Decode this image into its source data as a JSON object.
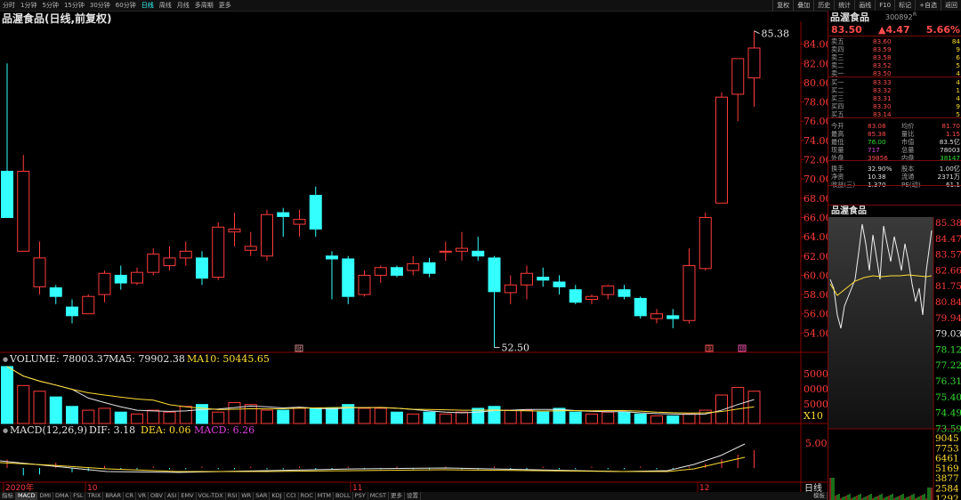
{
  "toolbar": {
    "periods": [
      "分时",
      "1分钟",
      "5分钟",
      "15分钟",
      "30分钟",
      "60分钟",
      "日线",
      "周线",
      "月线",
      "多周期",
      "更多"
    ],
    "active_period": "日线",
    "tools": [
      "复权",
      "叠加",
      "历史",
      "统计",
      "画线",
      "F10",
      "标记",
      "+自选",
      "返回"
    ]
  },
  "chart": {
    "title": "品渥食品(日线,前复权)",
    "price_ticks": [
      "84.00",
      "82.00",
      "80.00",
      "78.00",
      "76.00",
      "74.00",
      "72.00",
      "70.00",
      "68.00",
      "66.00",
      "64.00",
      "62.00",
      "60.00",
      "58.00",
      "56.00",
      "54.00"
    ],
    "high_label": "85.38",
    "low_label": "52.50",
    "markers": [
      "财",
      "涨",
      "预"
    ],
    "volume_legend": {
      "vol": "VOLUME: 78003.37",
      "ma5": "MA5: 79902.38",
      "ma10": "MA10: 50445.65"
    },
    "volume_ticks": [
      "5000",
      "0000",
      "5000",
      "X10"
    ],
    "macd_legend": {
      "params": "MACD(12,26,9)",
      "dif": "DIF: 3.18",
      "dea": "DEA: 0.06",
      "macd": "MACD: 6.26"
    },
    "macd_ticks": [
      "5.00"
    ],
    "date_labels": [
      "2020年",
      "10",
      "11",
      "12"
    ],
    "bottom_right_label": "日线",
    "bottom_tabs": [
      "指标",
      "MACD",
      "DMI",
      "DMA",
      "FSL",
      "TRIX",
      "BRAR",
      "CR",
      "VR",
      "OBV",
      "ASI",
      "EMV",
      "VOL-TDX",
      "RSI",
      "WR",
      "SAR",
      "KDJ",
      "CCI",
      "ROC",
      "MTM",
      "BOLL",
      "PSY",
      "MCST",
      "更多",
      "设置"
    ],
    "bottom_tab_active": "MACD",
    "bottom_right_tab": "模板"
  },
  "chart_data": {
    "type": "candlestick",
    "candles": [
      {
        "o": 70.8,
        "c": 66.0,
        "h": 82.0,
        "l": 66.0
      },
      {
        "o": 62.5,
        "c": 70.8,
        "h": 72.5,
        "l": 62.5
      },
      {
        "o": 58.8,
        "c": 61.8,
        "h": 63.5,
        "l": 58.0
      },
      {
        "o": 58.7,
        "c": 57.8,
        "h": 59.0,
        "l": 57.0
      },
      {
        "o": 56.7,
        "c": 55.8,
        "h": 57.5,
        "l": 55.0
      },
      {
        "o": 56.0,
        "c": 57.8,
        "h": 58.0,
        "l": 56.0
      },
      {
        "o": 58.0,
        "c": 60.2,
        "h": 60.5,
        "l": 57.2
      },
      {
        "o": 60.0,
        "c": 59.2,
        "h": 61.0,
        "l": 58.5
      },
      {
        "o": 59.2,
        "c": 60.3,
        "h": 60.8,
        "l": 59.0
      },
      {
        "o": 60.3,
        "c": 62.2,
        "h": 62.8,
        "l": 60.0
      },
      {
        "o": 61.0,
        "c": 61.8,
        "h": 63.0,
        "l": 60.5
      },
      {
        "o": 61.8,
        "c": 62.5,
        "h": 63.5,
        "l": 61.0
      },
      {
        "o": 61.8,
        "c": 59.7,
        "h": 62.5,
        "l": 59.0
      },
      {
        "o": 59.8,
        "c": 65.0,
        "h": 65.5,
        "l": 59.5
      },
      {
        "o": 64.5,
        "c": 64.8,
        "h": 66.5,
        "l": 63.0
      },
      {
        "o": 62.6,
        "c": 63.0,
        "h": 64.5,
        "l": 62.0
      },
      {
        "o": 62.0,
        "c": 66.3,
        "h": 66.8,
        "l": 61.5
      },
      {
        "o": 66.5,
        "c": 66.1,
        "h": 67.0,
        "l": 64.0
      },
      {
        "o": 65.3,
        "c": 65.8,
        "h": 66.8,
        "l": 64.0
      },
      {
        "o": 68.3,
        "c": 64.8,
        "h": 69.2,
        "l": 64.0
      },
      {
        "o": 62.0,
        "c": 61.7,
        "h": 62.5,
        "l": 57.5
      },
      {
        "o": 61.7,
        "c": 57.8,
        "h": 62.0,
        "l": 57.0
      },
      {
        "o": 58.0,
        "c": 60.0,
        "h": 60.5,
        "l": 57.8
      },
      {
        "o": 60.0,
        "c": 60.8,
        "h": 61.0,
        "l": 59.2
      },
      {
        "o": 60.8,
        "c": 60.0,
        "h": 61.0,
        "l": 59.8
      },
      {
        "o": 60.5,
        "c": 61.2,
        "h": 62.0,
        "l": 60.0
      },
      {
        "o": 61.3,
        "c": 60.2,
        "h": 61.8,
        "l": 59.8
      },
      {
        "o": 62.5,
        "c": 62.5,
        "h": 63.5,
        "l": 61.5
      },
      {
        "o": 62.5,
        "c": 62.8,
        "h": 64.5,
        "l": 61.5
      },
      {
        "o": 62.5,
        "c": 62.0,
        "h": 64.0,
        "l": 61.5
      },
      {
        "o": 61.8,
        "c": 58.3,
        "h": 62.0,
        "l": 52.5
      },
      {
        "o": 58.2,
        "c": 59.0,
        "h": 60.0,
        "l": 57.0
      },
      {
        "o": 59.0,
        "c": 60.2,
        "h": 61.0,
        "l": 57.5
      },
      {
        "o": 59.8,
        "c": 59.5,
        "h": 60.8,
        "l": 58.8
      },
      {
        "o": 59.3,
        "c": 58.8,
        "h": 60.0,
        "l": 58.0
      },
      {
        "o": 58.5,
        "c": 57.2,
        "h": 59.0,
        "l": 57.0
      },
      {
        "o": 57.5,
        "c": 57.8,
        "h": 58.0,
        "l": 57.0
      },
      {
        "o": 58.0,
        "c": 58.9,
        "h": 59.0,
        "l": 57.5
      },
      {
        "o": 58.5,
        "c": 57.8,
        "h": 59.0,
        "l": 57.5
      },
      {
        "o": 57.6,
        "c": 55.8,
        "h": 57.8,
        "l": 55.5
      },
      {
        "o": 55.5,
        "c": 56.0,
        "h": 56.5,
        "l": 55.0
      },
      {
        "o": 55.8,
        "c": 55.5,
        "h": 56.5,
        "l": 54.5
      },
      {
        "o": 55.3,
        "c": 61.0,
        "h": 62.8,
        "l": 55.0
      },
      {
        "o": 60.7,
        "c": 66.0,
        "h": 66.5,
        "l": 60.5
      },
      {
        "o": 67.5,
        "c": 78.5,
        "h": 79.0,
        "l": 67.5
      },
      {
        "o": 78.8,
        "c": 82.5,
        "h": 82.5,
        "l": 76.0
      },
      {
        "o": 80.5,
        "c": 83.6,
        "h": 85.38,
        "l": 77.5
      }
    ],
    "volume": [
      300,
      200,
      170,
      140,
      90,
      70,
      80,
      60,
      50,
      70,
      60,
      90,
      100,
      60,
      110,
      100,
      70,
      70,
      80,
      80,
      80,
      100,
      80,
      80,
      60,
      50,
      60,
      50,
      60,
      80,
      90,
      70,
      70,
      60,
      80,
      60,
      50,
      60,
      60,
      50,
      40,
      40,
      50,
      70,
      150,
      190,
      170
    ],
    "ylim": [
      52,
      86
    ]
  },
  "right_panel": {
    "name": "品渥食品",
    "code": "300892",
    "code_sup": "R",
    "price": "83.50",
    "change": "▲4.47",
    "pct": "5.66%",
    "asks": [
      {
        "label": "卖五",
        "price": "83.60",
        "vol": "84"
      },
      {
        "label": "卖四",
        "price": "83.59",
        "vol": "9"
      },
      {
        "label": "卖三",
        "price": "83.58",
        "vol": "6"
      },
      {
        "label": "卖二",
        "price": "83.52",
        "vol": "5"
      },
      {
        "label": "卖一",
        "price": "83.50",
        "vol": "4"
      }
    ],
    "bids": [
      {
        "label": "买一",
        "price": "83.33",
        "vol": "4"
      },
      {
        "label": "买二",
        "price": "83.32",
        "vol": "1"
      },
      {
        "label": "买三",
        "price": "83.31",
        "vol": "4"
      },
      {
        "label": "买四",
        "price": "83.30",
        "vol": "9"
      },
      {
        "label": "买五",
        "price": "83.14",
        "vol": "5"
      }
    ],
    "stats": [
      {
        "k1": "今开",
        "v1": "83.08",
        "k2": "均价",
        "v2": "81.70"
      },
      {
        "k1": "最高",
        "v1": "85.38",
        "k2": "量比",
        "v2": "1.15"
      },
      {
        "k1": "最低",
        "v1": "76.00",
        "k2": "市值",
        "v2": "83.5亿"
      },
      {
        "k1": "现量",
        "v1": "717",
        "k2": "总量",
        "v2": "78003"
      },
      {
        "k1": "外盘",
        "v1": "39856",
        "k2": "内盘",
        "v2": "38147"
      },
      {
        "k1": "换手",
        "v1": "32.90%",
        "k2": "股本",
        "v2": "1.00亿"
      },
      {
        "k1": "净资",
        "v1": "10.38",
        "k2": "流通",
        "v2": "2371万"
      },
      {
        "k1": "收益(三)",
        "v1": "1.370",
        "k2": "PE(动)",
        "v2": "61.1"
      }
    ],
    "mini_title": "品渥食品",
    "mini_price_ticks": [
      "85.38",
      "84.47",
      "83.57",
      "82.66",
      "81.75",
      "80.84",
      "79.94",
      "79.03",
      "78.12",
      "77.22",
      "76.31",
      "75.40",
      "74.49",
      "73.59"
    ],
    "mini_vol_ticks": [
      "9045",
      "7753",
      "6461",
      "5169",
      "3877",
      "2584",
      "1292"
    ]
  }
}
